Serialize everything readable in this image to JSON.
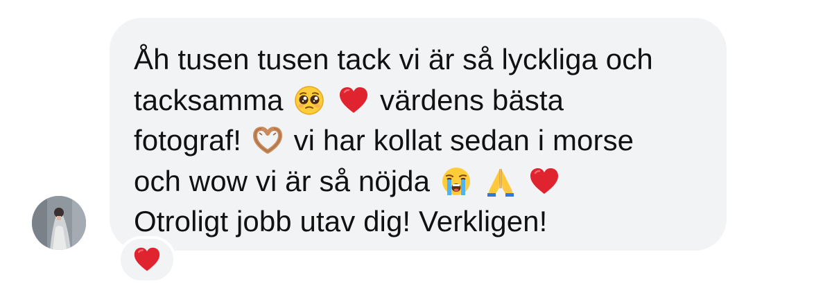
{
  "message": {
    "lines": [
      {
        "before": "Åh tusen tusen tack vi är så lyckliga och",
        "after": ""
      },
      {
        "before": "tacksamma",
        "after": "värdens bästa"
      },
      {
        "before": "fotograf!",
        "after": "vi har kollat sedan i morse"
      },
      {
        "before": "och wow vi är så nöjda",
        "after": ""
      },
      {
        "before": "Otroligt jobb utav dig! Verkligen!",
        "after": ""
      }
    ],
    "emojis": {
      "line2": [
        "pleading-face-emoji",
        "red-heart-emoji"
      ],
      "line3": [
        "heart-hands-emoji"
      ],
      "line4": [
        "loudly-crying-face-emoji",
        "folded-hands-emoji",
        "red-heart-emoji"
      ]
    }
  },
  "reaction": {
    "emoji": "red-heart-emoji"
  },
  "colors": {
    "bubble": "#f2f3f5",
    "text": "#111111",
    "heart": "#e0242f",
    "background": "#ffffff"
  }
}
